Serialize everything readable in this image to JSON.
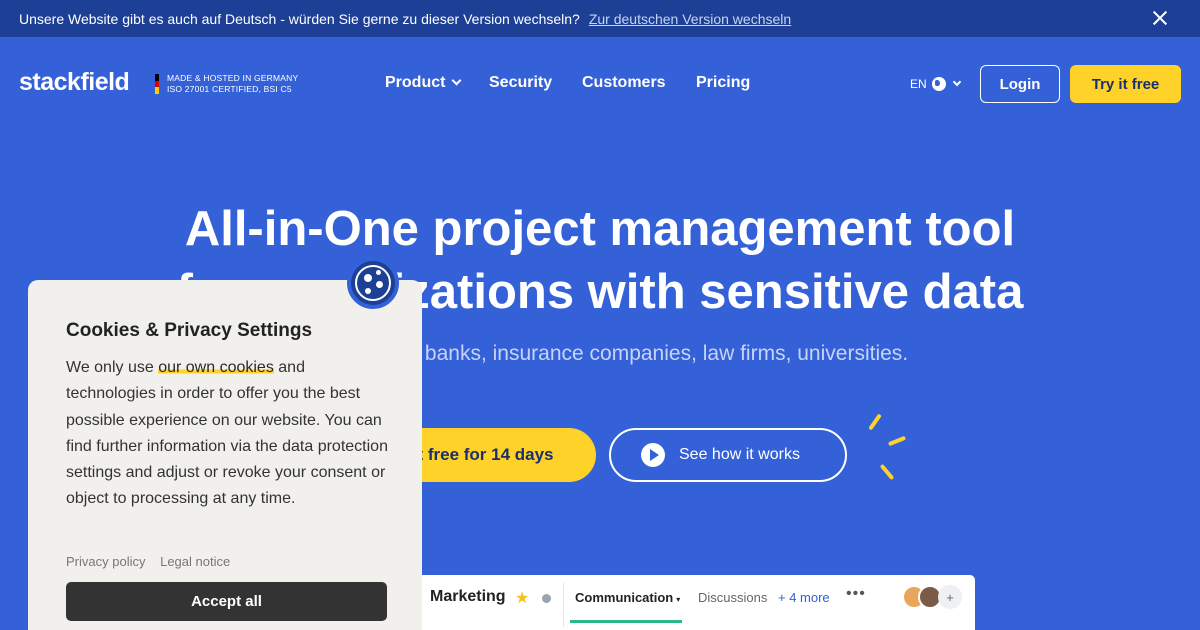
{
  "announcement": {
    "message": "Unsere Website gibt es auch auf Deutsch - würden Sie gerne zu dieser Version wechseln?",
    "link": "Zur deutschen Version wechseln"
  },
  "header": {
    "logo": "stackfield",
    "cert_line1": "MADE & HOSTED IN GERMANY",
    "cert_line2": "ISO 27001 CERTIFIED, BSI C5",
    "nav": [
      "Product",
      "Security",
      "Customers",
      "Pricing"
    ],
    "language": "EN",
    "login": "Login",
    "try_free": "Try it free"
  },
  "hero": {
    "title_line1": "All-in-One project management tool",
    "title_line2": "for organizations with sensitive data",
    "subtitle": "For agencies, banks, insurance companies, law firms, universities.",
    "cta_primary": "Try it free for 14 days",
    "cta_secondary": "See how it works"
  },
  "preview": {
    "room_title": "Marketing",
    "tab_active": "Communication",
    "tab_other": "Discussions",
    "more": "+ 4 more",
    "dots": "•••",
    "plus": "+"
  },
  "cookie": {
    "title": "Cookies & Privacy Settings",
    "body_before": "We only use ",
    "body_highlight": "our own cookies",
    "body_after": " and technologies in order to offer you the best possible experience on our website. You can find further information via the data protection settings and adjust or revoke your consent or object to processing at any time.",
    "privacy_policy": "Privacy policy",
    "legal_notice": "Legal notice",
    "accept_all": "Accept all"
  },
  "colors": {
    "background": "#3461d8",
    "topbar": "#1d3f95",
    "accent": "#ffd22a",
    "cookie_panel": "#f1f0ec"
  }
}
